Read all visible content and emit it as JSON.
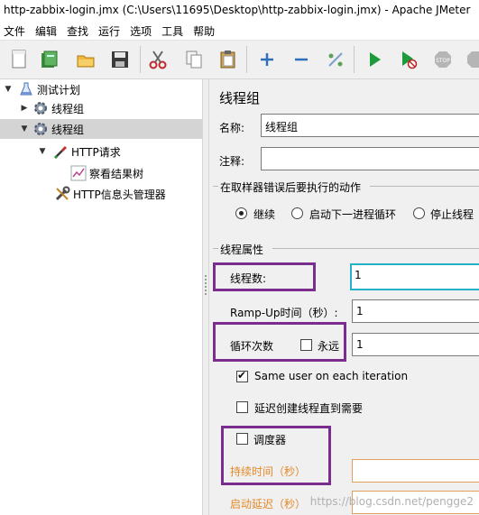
{
  "window": {
    "title": "http-zabbix-login.jmx (C:\\Users\\11695\\Desktop\\http-zabbix-login.jmx) - Apache JMeter"
  },
  "menu": [
    "文件",
    "编辑",
    "查找",
    "运行",
    "选项",
    "工具",
    "帮助"
  ],
  "toolbar": {
    "icons": [
      "new-icon",
      "templates-icon",
      "open-icon",
      "save-icon",
      "cut-icon",
      "copy-icon",
      "paste-icon",
      "expand-icon",
      "collapse-icon",
      "toggle-icon",
      "start-icon",
      "start-no-pause-icon",
      "stop-icon",
      "shutdown-icon"
    ]
  },
  "tree": {
    "items": [
      {
        "label": "测试计划",
        "icon": "test-plan-icon"
      },
      {
        "label": "线程组",
        "icon": "gear-icon"
      },
      {
        "label": "线程组",
        "icon": "gear-icon"
      },
      {
        "label": "HTTP请求",
        "icon": "pipette-icon"
      },
      {
        "label": "察看结果树",
        "icon": "chart-icon"
      },
      {
        "label": "HTTP信息头管理器",
        "icon": "wrench-icon"
      }
    ]
  },
  "panel": {
    "title": "线程组",
    "name_label": "名称:",
    "name_value": "线程组",
    "comment_label": "注释:",
    "comment_value": "",
    "error_section_title": "在取样器错误后要执行的动作",
    "error_options": [
      "继续",
      "启动下一进程循环",
      "停止线程"
    ],
    "error_selected": "继续",
    "thread_props_title": "线程属性",
    "threads_label": "线程数:",
    "threads_value": "1",
    "rampup_label": "Ramp-Up时间（秒）:",
    "rampup_value": "1",
    "loop_label": "循环次数",
    "forever_label": "永远",
    "forever_checked": false,
    "loop_value": "1",
    "same_user_label": "Same user on each iteration",
    "same_user_checked": true,
    "delay_create_label": "延迟创建线程直到需要",
    "delay_create_checked": false,
    "scheduler_label": "调度器",
    "scheduler_checked": false,
    "duration_label": "持续时间（秒）",
    "startup_delay_label": "启动延迟（秒）"
  },
  "watermark": "https://blog.csdn.net/pengge2",
  "colors": {
    "highlight_box": "#7b2d8e",
    "focus_border": "#22b3c8",
    "disabled_label": "#e48a2a"
  }
}
